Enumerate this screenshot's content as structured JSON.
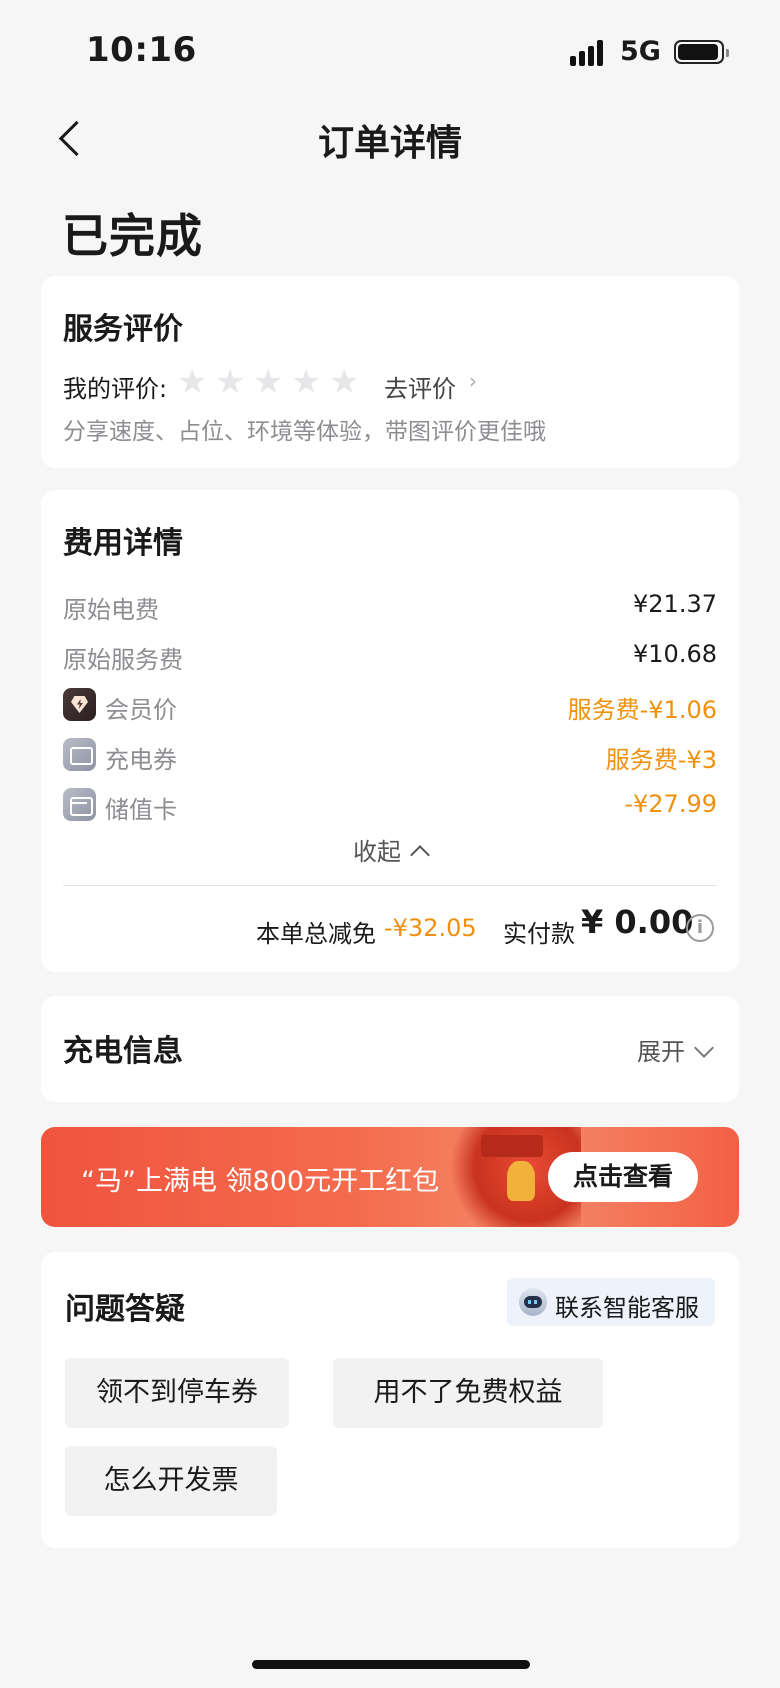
{
  "status_bar": {
    "time": "10:16",
    "network": "5G"
  },
  "nav": {
    "title": "订单详情"
  },
  "order_status": "已完成",
  "rating": {
    "title": "服务评价",
    "my_rating_label": "我的评价:",
    "stars": 0,
    "star_glyph": "★",
    "go_rate": "去评价",
    "go_rate_arrow": "›",
    "hint": "分享速度、占位、环境等体验，带图评价更佳哦"
  },
  "fees": {
    "title": "费用详情",
    "rows": [
      {
        "label": "原始电费",
        "value": "¥21.37"
      },
      {
        "label": "原始服务费",
        "value": "¥10.68"
      },
      {
        "label": "会员价",
        "value": "服务费-¥1.06",
        "icon": "member-diamond-icon"
      },
      {
        "label": "充电券",
        "value": "服务费-¥3",
        "icon": "coupon-icon"
      },
      {
        "label": "储值卡",
        "value": "-¥27.99",
        "icon": "stored-value-card-icon"
      }
    ],
    "collapse_label": "收起",
    "total_discount_label": "本单总减免",
    "total_discount_value": "-¥32.05",
    "paid_label": "实付款",
    "paid_value": "¥ 0.00",
    "info_glyph": "i"
  },
  "charging": {
    "title": "充电信息",
    "expand_label": "展开"
  },
  "banner": {
    "text": "“马”上满电 领800元开工红包",
    "button": "点击查看"
  },
  "faq": {
    "title": "问题答疑",
    "service_label": "联系智能客服",
    "chips": [
      "领不到停车券",
      "用不了免费权益",
      "怎么开发票"
    ]
  },
  "colors": {
    "accent_orange": "#f0900f",
    "banner_red": "#f0543f",
    "background": "#f6f6f7"
  }
}
